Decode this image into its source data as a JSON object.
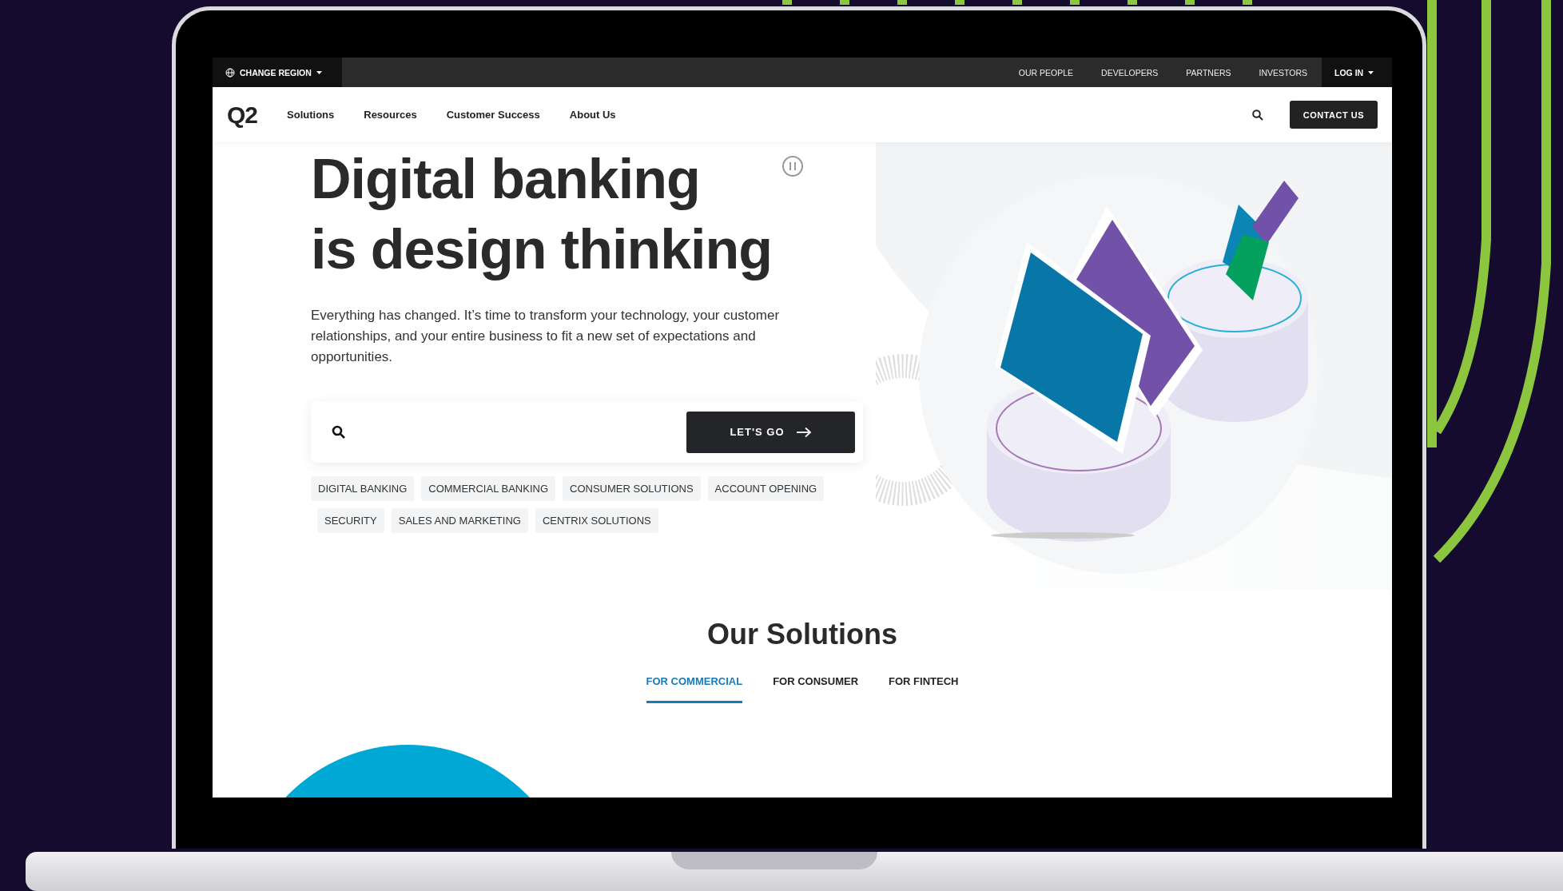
{
  "utility_bar": {
    "region": "CHANGE REGION",
    "links": [
      "OUR PEOPLE",
      "DEVELOPERS",
      "PARTNERS",
      "INVESTORS"
    ],
    "login": "LOG IN"
  },
  "nav": {
    "logo": "Q2",
    "links": [
      "Solutions",
      "Resources",
      "Customer Success",
      "About Us"
    ],
    "cta": "CONTACT US"
  },
  "hero": {
    "heading_lines": [
      "Digital banking",
      "is design thinking"
    ],
    "description": "Everything has changed. It’s time to transform your technology, your customer relationships, and your entire business to fit a new set of expectations and opportunities.",
    "search": {
      "button": "LET'S GO"
    },
    "tag_rows": [
      [
        "DIGITAL BANKING",
        "COMMERCIAL BANKING",
        "CONSUMER SOLUTIONS",
        "ACCOUNT OPENING"
      ],
      [
        "SECURITY",
        "SALES AND MARKETING",
        "CENTRIX SOLUTIONS"
      ]
    ]
  },
  "solutions": {
    "title": "Our Solutions",
    "tabs": [
      {
        "label": "FOR COMMERCIAL",
        "selected": true
      },
      {
        "label": "FOR CONSUMER",
        "selected": false
      },
      {
        "label": "FOR FINTECH",
        "selected": false
      }
    ]
  }
}
